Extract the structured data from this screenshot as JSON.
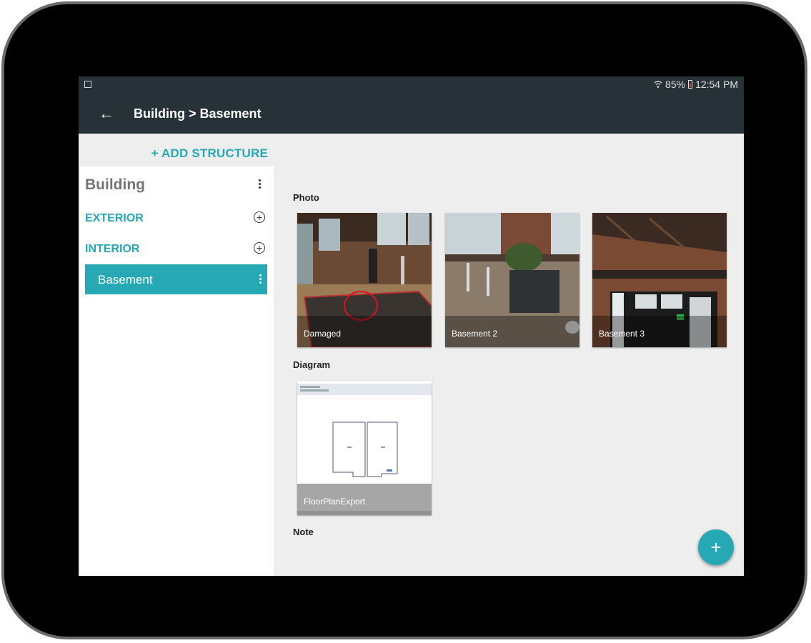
{
  "status": {
    "battery": "85%",
    "time": "12:54 PM"
  },
  "appbar": {
    "breadcrumb": "Building > Basement"
  },
  "sidebar": {
    "add_structure": "+ ADD STRUCTURE",
    "building": "Building",
    "sections": [
      "EXTERIOR",
      "INTERIOR"
    ],
    "selected": "Basement"
  },
  "main": {
    "photo_header": "Photo",
    "photos": [
      "Damaged",
      "Basement 2",
      "Basement 3"
    ],
    "diagram_header": "Diagram",
    "diagrams": [
      "FloorPlanExport"
    ],
    "note_header": "Note"
  },
  "colors": {
    "appbar": "#263238",
    "accent": "#26a9b4",
    "background": "#eeeeee"
  }
}
